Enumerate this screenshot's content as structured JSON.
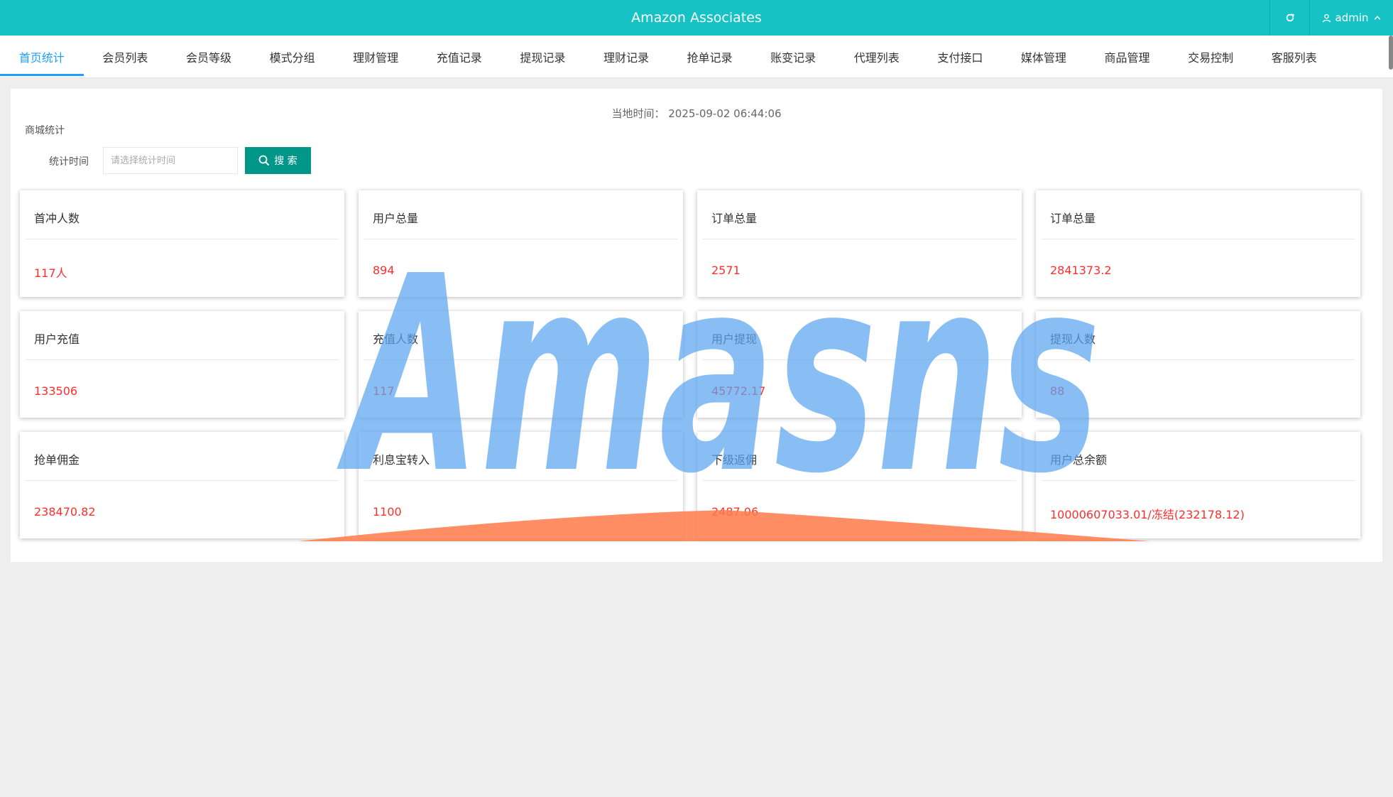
{
  "header": {
    "app_title": "Amazon Associates",
    "user_label": "admin",
    "accent_color": "#16c2c3"
  },
  "nav": {
    "items": [
      {
        "label": "首页统计",
        "active": true
      },
      {
        "label": "会员列表"
      },
      {
        "label": "会员等级"
      },
      {
        "label": "模式分组"
      },
      {
        "label": "理财管理"
      },
      {
        "label": "充值记录"
      },
      {
        "label": "提现记录"
      },
      {
        "label": "理财记录"
      },
      {
        "label": "抢单记录"
      },
      {
        "label": "账变记录"
      },
      {
        "label": "代理列表"
      },
      {
        "label": "支付接口"
      },
      {
        "label": "媒体管理"
      },
      {
        "label": "商品管理"
      },
      {
        "label": "交易控制"
      },
      {
        "label": "客服列表"
      }
    ]
  },
  "main": {
    "local_time_label": "当地时间：",
    "local_time_value": "2025-09-02 06:44:06",
    "section_title": "商城统计",
    "filter": {
      "label": "统计时间",
      "placeholder": "请选择统计时间",
      "search_label": "搜 索"
    },
    "cards": [
      {
        "title": "首冲人数",
        "value": "117人"
      },
      {
        "title": "用户总量",
        "value": "894"
      },
      {
        "title": "订单总量",
        "value": "2571"
      },
      {
        "title": "订单总量",
        "value": "2841373.2"
      },
      {
        "title": "用户充值",
        "value": "133506"
      },
      {
        "title": "充值人数",
        "value": "117"
      },
      {
        "title": "用户提现",
        "value": "45772.17"
      },
      {
        "title": "提现人数",
        "value": "88"
      },
      {
        "title": "抢单佣金",
        "value": "238470.82"
      },
      {
        "title": "利息宝转入",
        "value": "1100"
      },
      {
        "title": "下级返佣",
        "value": "2487.06"
      },
      {
        "title": "用户总余额",
        "value": "10000607033.01/冻结(232178.12)"
      }
    ]
  },
  "colors": {
    "active_tab": "#1e9fff",
    "search_button": "#009688",
    "value_text": "#ff2d2d",
    "watermark_blue": "#5aa5f0",
    "watermark_orange": "#ff7a4a"
  },
  "watermark": {
    "text": "Amasns"
  }
}
